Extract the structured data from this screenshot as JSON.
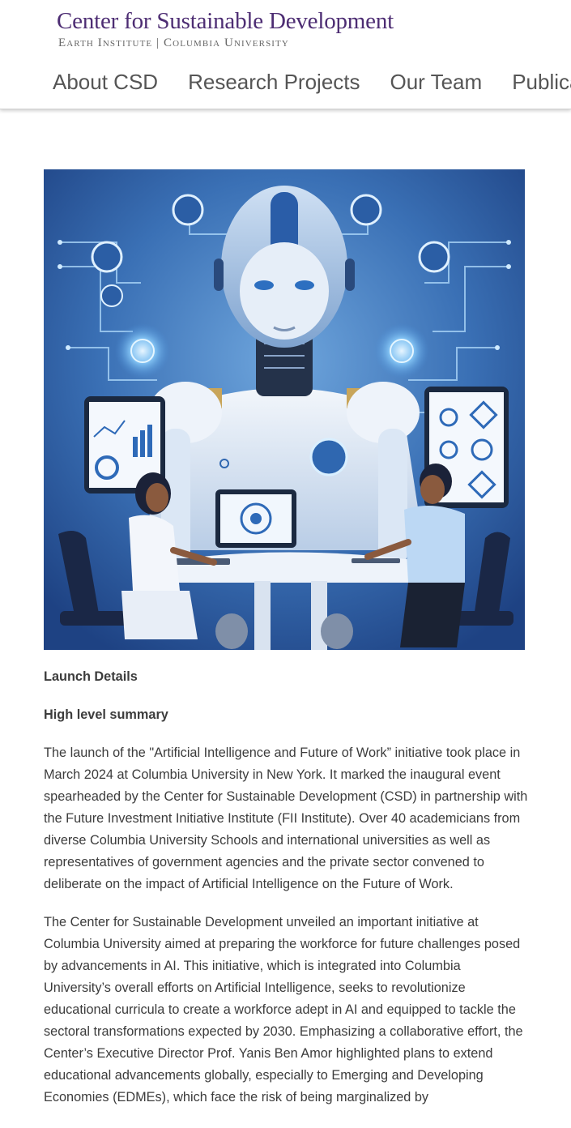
{
  "site": {
    "title": "Center for Sustainable Development",
    "subtitle": "Earth Institute | Columbia University"
  },
  "nav": {
    "items": [
      "About CSD",
      "Research Projects",
      "Our Team",
      "Publications"
    ]
  },
  "hero": {
    "alt": "AI robot with two people working at desk illustration"
  },
  "article": {
    "section_title": "Launch Details",
    "summary_title": "High level summary",
    "paragraph1": "The launch of the \"Artificial Intelligence and Future of Work” initiative took place in March 2024 at Columbia University in New York. It marked the inaugural event spearheaded by the Center for Sustainable Development (CSD) in partnership with the Future Investment Initiative Institute (FII Institute). Over 40 academicians from diverse Columbia University Schools and international universities as well as representatives of government agencies and the private sector convened to deliberate on the impact of Artificial Intelligence on the Future of Work.",
    "paragraph2": "The Center for Sustainable Development unveiled an important initiative at Columbia University aimed at preparing the workforce for future challenges posed by advancements in AI. This initiative, which is integrated into Columbia University’s overall efforts on Artificial Intelligence, seeks to revolutionize educational curricula to create a workforce adept in AI and equipped to tackle the sectoral transformations expected by 2030. Emphasizing a collaborative effort, the Center’s Executive Director Prof. Yanis Ben Amor highlighted plans to extend educational advancements globally, especially to Emerging and Developing Economies (EDMEs), which face the risk of being marginalized by"
  },
  "colors": {
    "brand_purple": "#4d2d73",
    "hero_bg": "#2d5a9e"
  }
}
